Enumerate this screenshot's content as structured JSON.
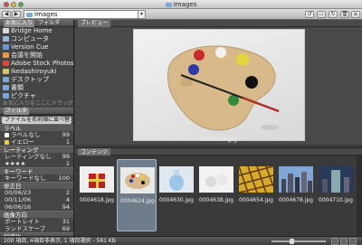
{
  "window": {
    "title": "Images"
  },
  "toolbar": {
    "path": "Images",
    "back_icon": "left-arrow-icon",
    "forward_icon": "right-arrow-icon"
  },
  "left_panel": {
    "tabs": [
      "お気に入り",
      "フォルダ"
    ],
    "favorites": [
      {
        "label": "Bridge Home",
        "icon": "bridge-icon",
        "color": "#d9d9d9"
      },
      {
        "label": "コンピュータ",
        "icon": "computer-icon",
        "color": "#9ab6d6"
      },
      {
        "label": "Version Cue",
        "icon": "version-cue-icon",
        "color": "#6b9ad6"
      },
      {
        "label": "会議を開始",
        "icon": "meeting-icon",
        "color": "#e89b3a"
      },
      {
        "label": "Adobe Stock Photos",
        "icon": "stock-photos-icon",
        "color": "#d94a3a"
      },
      {
        "label": "ikedashiroyuki",
        "icon": "home-icon",
        "color": "#d8c46a"
      },
      {
        "label": "デスクトップ",
        "icon": "desktop-icon",
        "color": "#7aa7d8"
      },
      {
        "label": "書類",
        "icon": "documents-icon",
        "color": "#7aa7d8"
      },
      {
        "label": "ピクチャ",
        "icon": "pictures-icon",
        "color": "#7aa7d8"
      }
    ],
    "favorites_hint": "お気に入りをここにドラッグ...",
    "filter_tab": "フィルタ",
    "filter_select": "ファイルを名前順に並べ替え",
    "filter_groups": [
      {
        "title": "ラベル",
        "rows": [
          {
            "label": "ラベルなし",
            "count": "99",
            "color": "#ffffff"
          },
          {
            "label": "イエロー",
            "count": "1",
            "color": "#e8d23a"
          }
        ]
      },
      {
        "title": "レーティング",
        "rows": [
          {
            "label": "レーティングなし",
            "count": "99"
          },
          {
            "label": "★★★★",
            "count": "1"
          }
        ]
      },
      {
        "title": "キーワード",
        "rows": [
          {
            "label": "キーワードなし",
            "count": "100"
          }
        ]
      },
      {
        "title": "修正日",
        "rows": [
          {
            "label": "00/06/23",
            "count": "2"
          },
          {
            "label": "00/11/06",
            "count": "4"
          },
          {
            "label": "06/06/16",
            "count": "94"
          }
        ]
      },
      {
        "title": "画像方向",
        "rows": [
          {
            "label": "ポートレイト",
            "count": "31"
          },
          {
            "label": "ランドスケープ",
            "count": "69"
          }
        ]
      },
      {
        "title": "縦横比",
        "rows": []
      }
    ]
  },
  "preview": {
    "tab": "プレビュー",
    "caption": "0004624.jpg"
  },
  "content": {
    "tab": "コンテンツ",
    "thumbnails": [
      {
        "caption": "0004618.jpg",
        "selected": false,
        "kind": "gift"
      },
      {
        "caption": "0004624.jpg",
        "selected": true,
        "kind": "palette"
      },
      {
        "caption": "0004630.jpg",
        "selected": false,
        "kind": "vase"
      },
      {
        "caption": "0004638.jpg",
        "selected": false,
        "kind": "balls"
      },
      {
        "caption": "0004654.jpg",
        "selected": false,
        "kind": "pattern"
      },
      {
        "caption": "0004678.jpg",
        "selected": false,
        "kind": "city"
      },
      {
        "caption": "0004710.jpg",
        "selected": false,
        "kind": "tower"
      }
    ]
  },
  "status": {
    "text": "100 項目, 4項目非表示, 1 項目選択 - 561 KB"
  }
}
